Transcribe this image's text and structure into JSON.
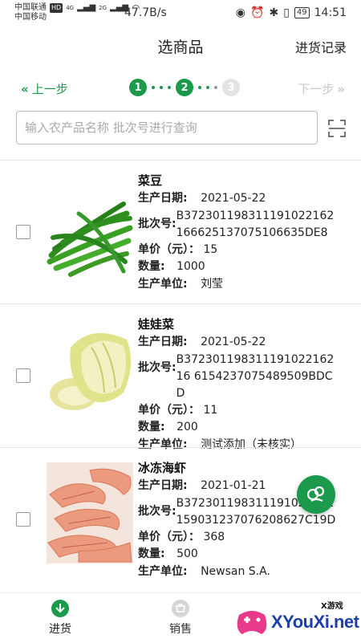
{
  "status_bar": {
    "carrier1": "中国联通",
    "carrier1_badge": "HD",
    "carrier2": "中国移动",
    "net1": "4G",
    "net2": "2G",
    "speed": "47.7B/s",
    "battery": "49",
    "time": "14:51"
  },
  "header": {
    "title": "选商品",
    "records_label": "进货记录"
  },
  "stepper": {
    "prev_label": "上一步",
    "next_label": "下一步",
    "steps": [
      "1",
      "2",
      "3"
    ],
    "current_step": 2
  },
  "search": {
    "placeholder": "输入农产品名称 批次号进行查询",
    "value": ""
  },
  "labels": {
    "production_date": "生产日期:",
    "batch_no": "批次号:",
    "unit_price": "单价（元）：",
    "quantity": "数量:",
    "producer": "生产单位:"
  },
  "products": [
    {
      "name": "菜豆",
      "production_date": "2021-05-22",
      "batch_no": "B372301198311191022162166625137075106635DE8",
      "unit_price": "15",
      "quantity": "1000",
      "producer": "刘莹",
      "image_icon": "green-bean-image"
    },
    {
      "name": "娃娃菜",
      "production_date": "2021-05-22",
      "batch_no": "B37230119831119102216216 6154237075489509BDCD",
      "unit_price": "11",
      "quantity": "200",
      "producer": "测试添加（未核实）",
      "image_icon": "baby-cabbage-image"
    },
    {
      "name": "冰冻海虾",
      "production_date": "2021-01-21",
      "batch_no": "B372301198311191022162159031237076208627C19D",
      "unit_price": "368",
      "quantity": "500",
      "producer": "Newsan S.A.",
      "image_icon": "frozen-shrimp-image"
    }
  ],
  "bottom_nav": {
    "tabs": [
      {
        "label": "进货",
        "active": true
      },
      {
        "label": "销售",
        "active": false
      }
    ]
  },
  "watermark": {
    "small": "X游戏",
    "text": "XYouXi.net"
  },
  "colors": {
    "accent": "#1a9a4a",
    "inactive": "#c9c9c9"
  }
}
